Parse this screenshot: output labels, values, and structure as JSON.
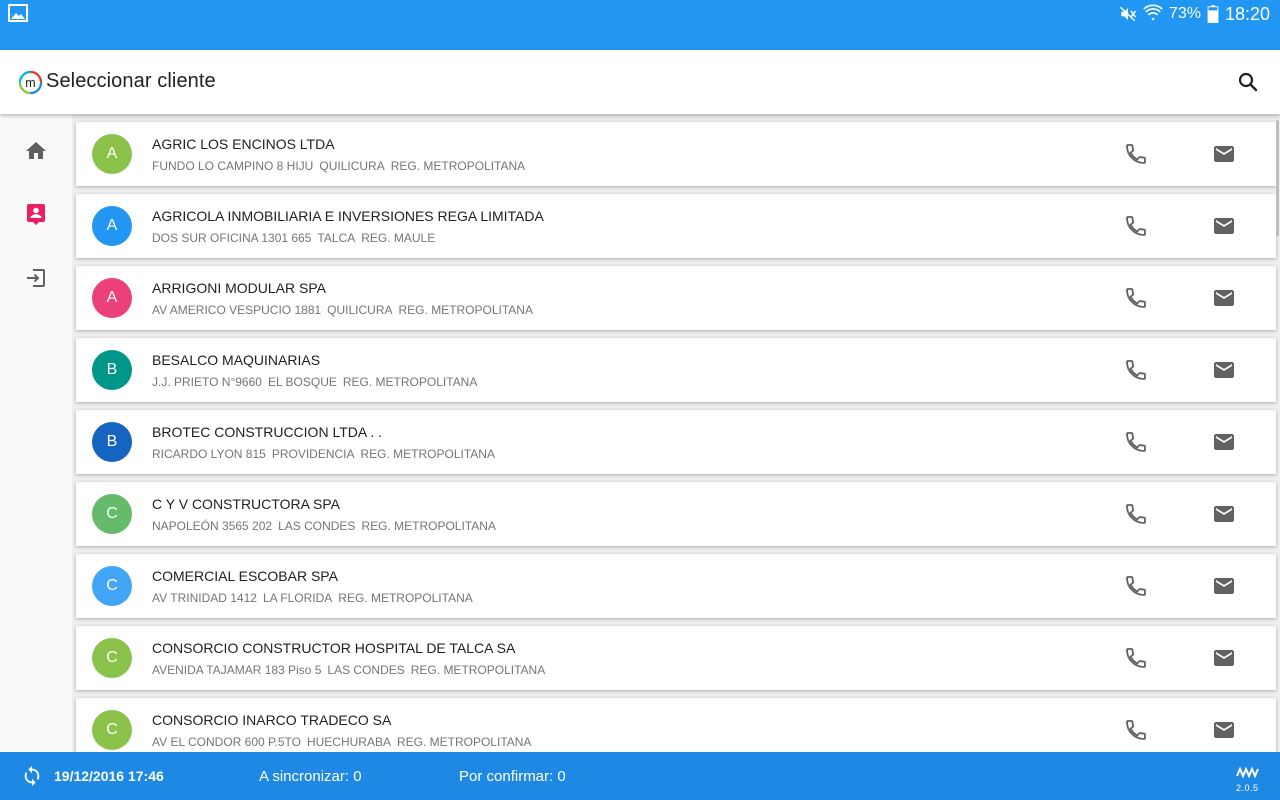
{
  "status_bar": {
    "left_icon": "gallery-notification-icon",
    "battery": "73%",
    "time": "18:20",
    "icons": [
      "mute-icon",
      "wifi-icon",
      "battery-icon"
    ]
  },
  "app_bar": {
    "title": "Seleccionar cliente",
    "logo_letter": "m",
    "search_icon": "search-icon"
  },
  "side_nav": {
    "items": [
      {
        "name": "home",
        "icon": "home-icon",
        "active": false
      },
      {
        "name": "clients",
        "icon": "contact-card-icon",
        "active": true
      },
      {
        "name": "logout",
        "icon": "exit-icon",
        "active": false
      }
    ],
    "active_color": "#e91e63"
  },
  "clients": [
    {
      "initial": "A",
      "color": "#8bc34a",
      "name": "AGRIC LOS ENCINOS LTDA",
      "address": [
        "FUNDO LO CAMPINO 8 HIJU",
        "QUILICURA",
        "REG. METROPOLITANA"
      ]
    },
    {
      "initial": "A",
      "color": "#2196f3",
      "name": "AGRICOLA INMOBILIARIA E INVERSIONES REGA LIMITADA",
      "address": [
        "DOS SUR OFICINA 1301 665",
        "TALCA",
        "REG. MAULE"
      ]
    },
    {
      "initial": "A",
      "color": "#ec407a",
      "name": "ARRIGONI MODULAR SPA",
      "address": [
        "AV AMERICO VESPUCIO 1881",
        "QUILICURA",
        "REG. METROPOLITANA"
      ]
    },
    {
      "initial": "B",
      "color": "#009688",
      "name": "BESALCO MAQUINARIAS",
      "address": [
        "J.J. PRIETO N°9660",
        "EL BOSQUE",
        "REG. METROPOLITANA"
      ]
    },
    {
      "initial": "B",
      "color": "#1565c0",
      "name": "BROTEC CONSTRUCCION LTDA . .",
      "address": [
        "RICARDO LYON 815",
        "PROVIDENCIA",
        "REG. METROPOLITANA"
      ]
    },
    {
      "initial": "C",
      "color": "#66bb6a",
      "name": "C Y V CONSTRUCTORA SPA",
      "address": [
        "NAPOLEÓN 3565 202",
        "LAS CONDES",
        "REG. METROPOLITANA"
      ]
    },
    {
      "initial": "C",
      "color": "#42a5f5",
      "name": "COMERCIAL ESCOBAR SPA",
      "address": [
        "AV TRINIDAD 1412",
        "LA FLORIDA",
        "REG. METROPOLITANA"
      ]
    },
    {
      "initial": "C",
      "color": "#8bc34a",
      "name": "CONSORCIO CONSTRUCTOR HOSPITAL DE TALCA SA",
      "address": [
        "AVENIDA TAJAMAR 183 Piso 5",
        "LAS CONDES",
        "REG. METROPOLITANA"
      ]
    },
    {
      "initial": "C",
      "color": "#8bc34a",
      "name": "CONSORCIO INARCO TRADECO SA",
      "address": [
        "AV EL CONDOR 600 P.5TO",
        "HUECHURABA",
        "REG. METROPOLITANA"
      ]
    }
  ],
  "row_icons": {
    "phone": "phone-icon",
    "email": "email-icon"
  },
  "bottom_bar": {
    "sync_icon": "sync-icon",
    "last_sync": "19/12/2016 17:46",
    "to_sync": "A sincronizar: 0",
    "to_confirm": "Por confirmar: 0",
    "version": "2.0.5",
    "brand_icon": "brand-logo-icon"
  },
  "colors": {
    "status_bar": "#2196f3",
    "bottom_bar": "#1e88e5",
    "icon_gray": "#616161"
  }
}
